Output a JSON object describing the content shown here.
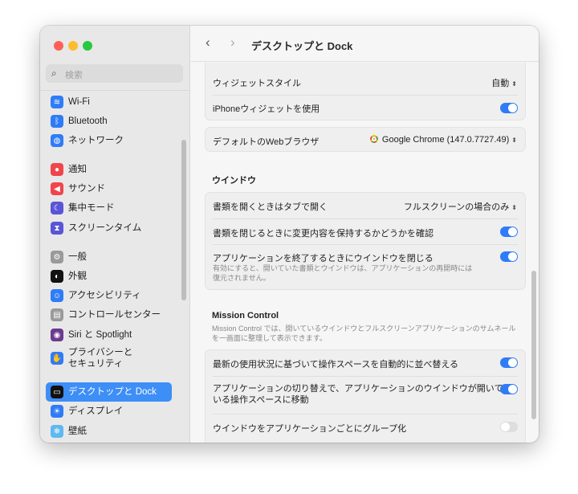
{
  "window": {
    "title": "デスクトップと Dock"
  },
  "sidebar": {
    "search_placeholder": "検索",
    "items": [
      {
        "label": "Wi-Fi",
        "color": "#2f7cf6",
        "glyph": "≋"
      },
      {
        "label": "Bluetooth",
        "color": "#2f7cf6",
        "glyph": "ᛒ"
      },
      {
        "label": "ネットワーク",
        "color": "#2f7cf6",
        "glyph": "◍"
      },
      {
        "label": "通知",
        "color": "#f0454b",
        "glyph": "●"
      },
      {
        "label": "サウンド",
        "color": "#f0454b",
        "glyph": "◀"
      },
      {
        "label": "集中モード",
        "color": "#5a55d6",
        "glyph": "☾"
      },
      {
        "label": "スクリーンタイム",
        "color": "#5a55d6",
        "glyph": "⧗"
      },
      {
        "label": "一般",
        "color": "#9a9a9a",
        "glyph": "⚙"
      },
      {
        "label": "外観",
        "color": "#111111",
        "glyph": "◐"
      },
      {
        "label": "アクセシビリティ",
        "color": "#2f7cf6",
        "glyph": "☺"
      },
      {
        "label": "コントロールセンター",
        "color": "#9a9a9a",
        "glyph": "▤"
      },
      {
        "label": "Siri と Spotlight",
        "color": "#6b3a8f",
        "glyph": "◉"
      },
      {
        "label": "プライバシーと",
        "label2": "セキュリティ",
        "color": "#2f7cf6",
        "glyph": "✋"
      },
      {
        "label": "デスクトップと Dock",
        "color": "#111111",
        "glyph": "▭"
      },
      {
        "label": "ディスプレイ",
        "color": "#2f7cf6",
        "glyph": "☀"
      },
      {
        "label": "壁紙",
        "color": "#5fb8f0",
        "glyph": "❄"
      }
    ]
  },
  "main": {
    "widget_style": {
      "label": "ウィジェットスタイル",
      "value": "自動"
    },
    "iphone_widget": {
      "label": "iPhoneウィジェットを使用",
      "on": true
    },
    "default_browser": {
      "label": "デフォルトのWebブラウザ",
      "value": "Google Chrome (147.0.7727.49)"
    },
    "windows_header": "ウインドウ",
    "open_docs_tabs": {
      "label": "書類を開くときはタブで開く",
      "value": "フルスクリーンの場合のみ"
    },
    "ask_keep_changes": {
      "label": "書類を閉じるときに変更内容を保持するかどうかを確認",
      "on": true
    },
    "close_windows": {
      "label": "アプリケーションを終了するときにウインドウを閉じる",
      "desc1": "有効にすると、開いていた書類とウインドウは、アプリケーションの再開時には",
      "desc2": "復元されません。",
      "on": true
    },
    "mission_header": "Mission Control",
    "mission_desc1": "Mission Control では、開いているウインドウとフルスクリーンアプリケーションのサムネール",
    "mission_desc2": "を一画面に整理して表示できます。",
    "auto_rearrange": {
      "label": "最新の使用状況に基づいて操作スペースを自動的に並べ替える",
      "on": true
    },
    "switch_space": {
      "label1": "アプリケーションの切り替えで、アプリケーションのウインドウが開いて",
      "label2": "いる操作スペースに移動",
      "on": true
    },
    "group_by_app": {
      "label": "ウインドウをアプリケーションごとにグループ化",
      "on": false
    }
  }
}
